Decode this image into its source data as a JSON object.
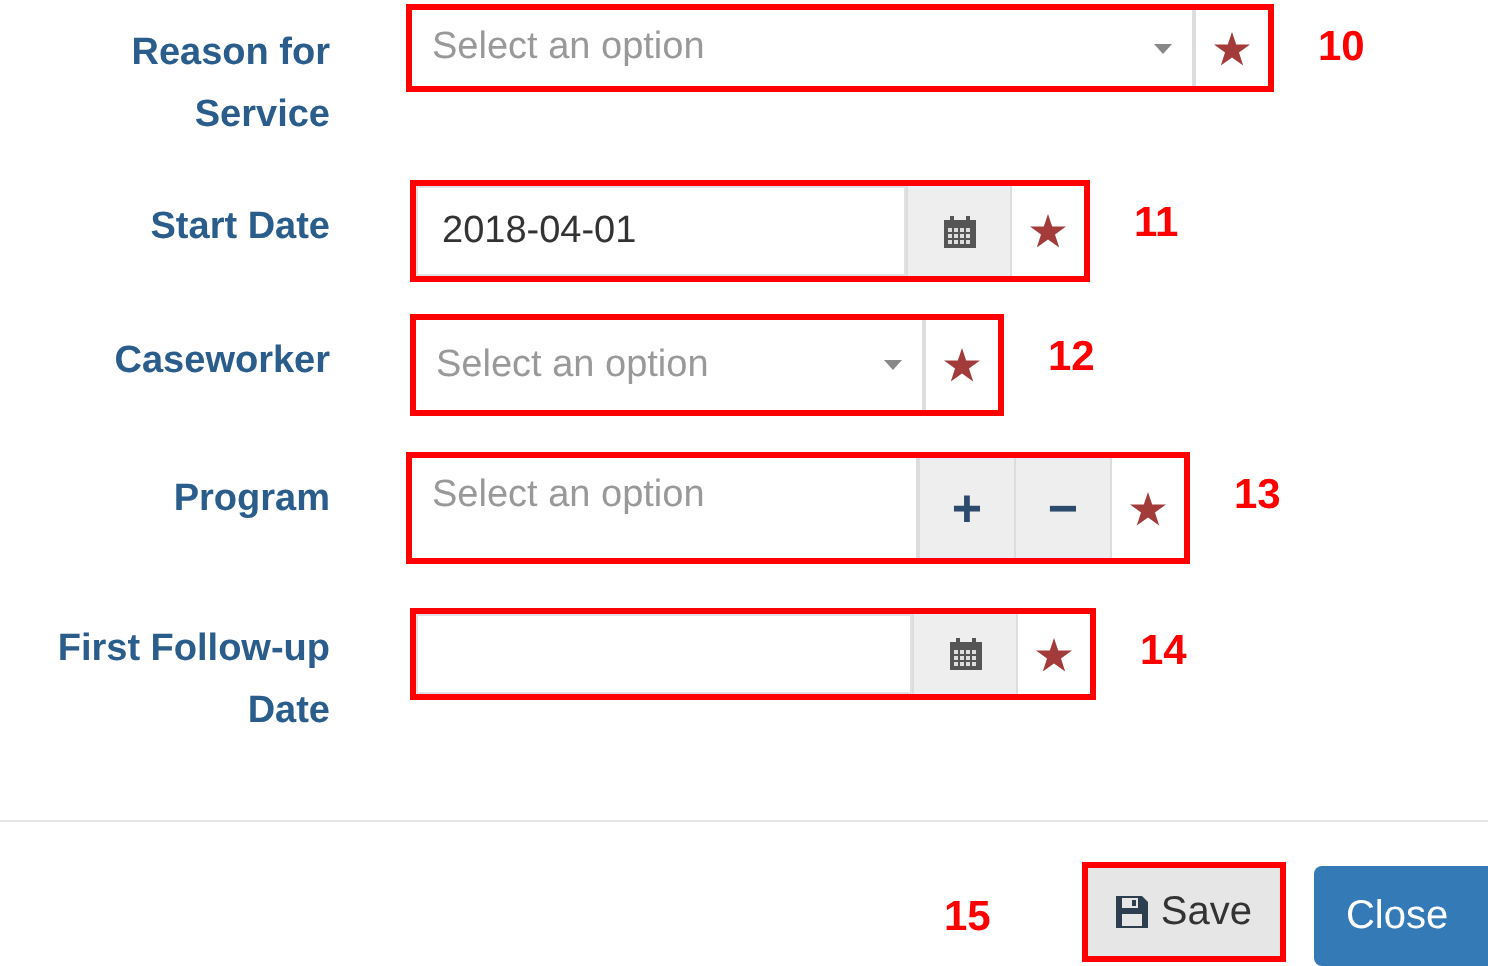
{
  "fields": [
    {
      "label": "Reason for Service",
      "kind": "select",
      "placeholder": "Select an option",
      "required": true,
      "callout": "10"
    },
    {
      "label": "Start Date",
      "kind": "date",
      "value": "2018-04-01",
      "required": true,
      "callout": "11"
    },
    {
      "label": "Caseworker",
      "kind": "select",
      "placeholder": "Select an option",
      "required": true,
      "callout": "12"
    },
    {
      "label": "Program",
      "kind": "select-add-remove",
      "placeholder": "Select an option",
      "add": "+",
      "remove": "−",
      "required": true,
      "callout": "13"
    },
    {
      "label": "First Follow-up Date",
      "kind": "date",
      "required": true,
      "callout": "14"
    }
  ],
  "footer": {
    "callout": "15",
    "save": "Save",
    "close": "Close"
  }
}
